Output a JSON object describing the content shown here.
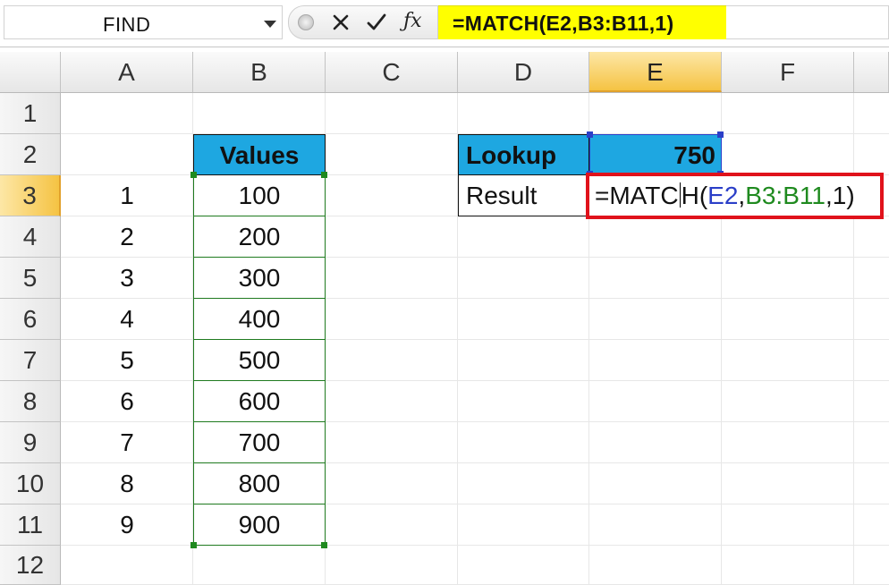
{
  "formula_bar": {
    "name_box": "FIND",
    "formula": "=MATCH(E2,B3:B11,1)"
  },
  "columns": [
    "A",
    "B",
    "C",
    "D",
    "E",
    "F"
  ],
  "active_column": "E",
  "rows": [
    "1",
    "2",
    "3",
    "4",
    "5",
    "6",
    "7",
    "8",
    "9",
    "10",
    "11",
    "12"
  ],
  "active_row": "3",
  "table": {
    "header": "Values",
    "rows": [
      {
        "index": "1",
        "value": "100"
      },
      {
        "index": "2",
        "value": "200"
      },
      {
        "index": "3",
        "value": "300"
      },
      {
        "index": "4",
        "value": "400"
      },
      {
        "index": "5",
        "value": "500"
      },
      {
        "index": "6",
        "value": "600"
      },
      {
        "index": "7",
        "value": "700"
      },
      {
        "index": "8",
        "value": "800"
      },
      {
        "index": "9",
        "value": "900"
      }
    ]
  },
  "lookup": {
    "label": "Lookup",
    "value": "750",
    "result_label": "Result",
    "formula_cell": {
      "prefix": "=MATC",
      "suffix": "H(",
      "ref_e2": "E2",
      "comma1": ",",
      "ref_range": "B3:B11",
      "tail": ",1)"
    }
  },
  "colors": {
    "header_fill": "#1ea7e1",
    "formula_highlight": "#ffff00",
    "edit_border": "#e0121b",
    "ref_blue": "#2b3fc8",
    "ref_green": "#1f8a1f",
    "active_header": "#f5c343"
  }
}
